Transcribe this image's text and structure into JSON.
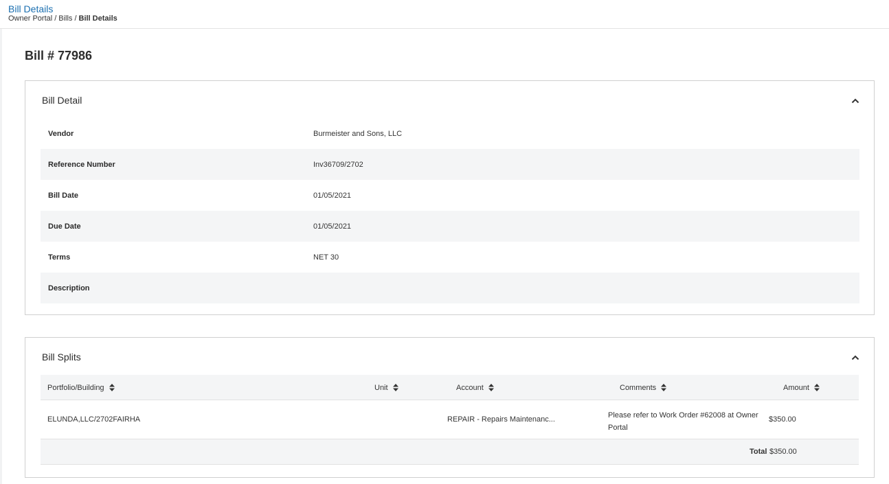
{
  "header": {
    "title": "Bill Details",
    "breadcrumb": [
      "Owner Portal",
      "Bills",
      "Bill Details"
    ]
  },
  "bill": {
    "title": "Bill # 77986"
  },
  "detail_card": {
    "title": "Bill Detail",
    "rows": [
      {
        "label": "Vendor",
        "value": "Burmeister and Sons, LLC"
      },
      {
        "label": "Reference Number",
        "value": "Inv36709/2702"
      },
      {
        "label": "Bill Date",
        "value": "01/05/2021"
      },
      {
        "label": "Due Date",
        "value": "01/05/2021"
      },
      {
        "label": "Terms",
        "value": "NET 30"
      },
      {
        "label": "Description",
        "value": ""
      }
    ]
  },
  "splits_card": {
    "title": "Bill Splits",
    "columns": [
      "Portfolio/Building",
      "Unit",
      "Account",
      "Comments",
      "Amount"
    ],
    "rows": [
      {
        "portfolio": "ELUNDA,LLC/2702FAIRHA",
        "unit": "",
        "account": "REPAIR - Repairs Maintenanc...",
        "comments_line1": "Please refer to Work Order #62008 at Owner",
        "comments_line2": "Portal",
        "amount": "$350.00"
      }
    ],
    "total_label": "Total",
    "total_value": "$350.00"
  },
  "icons": {
    "collapse": "chevron-up-icon",
    "sort": "sort-icon"
  },
  "colors": {
    "link": "#1a6fb0",
    "row_alt": "#f4f5f6",
    "border": "#cfcfcf"
  }
}
